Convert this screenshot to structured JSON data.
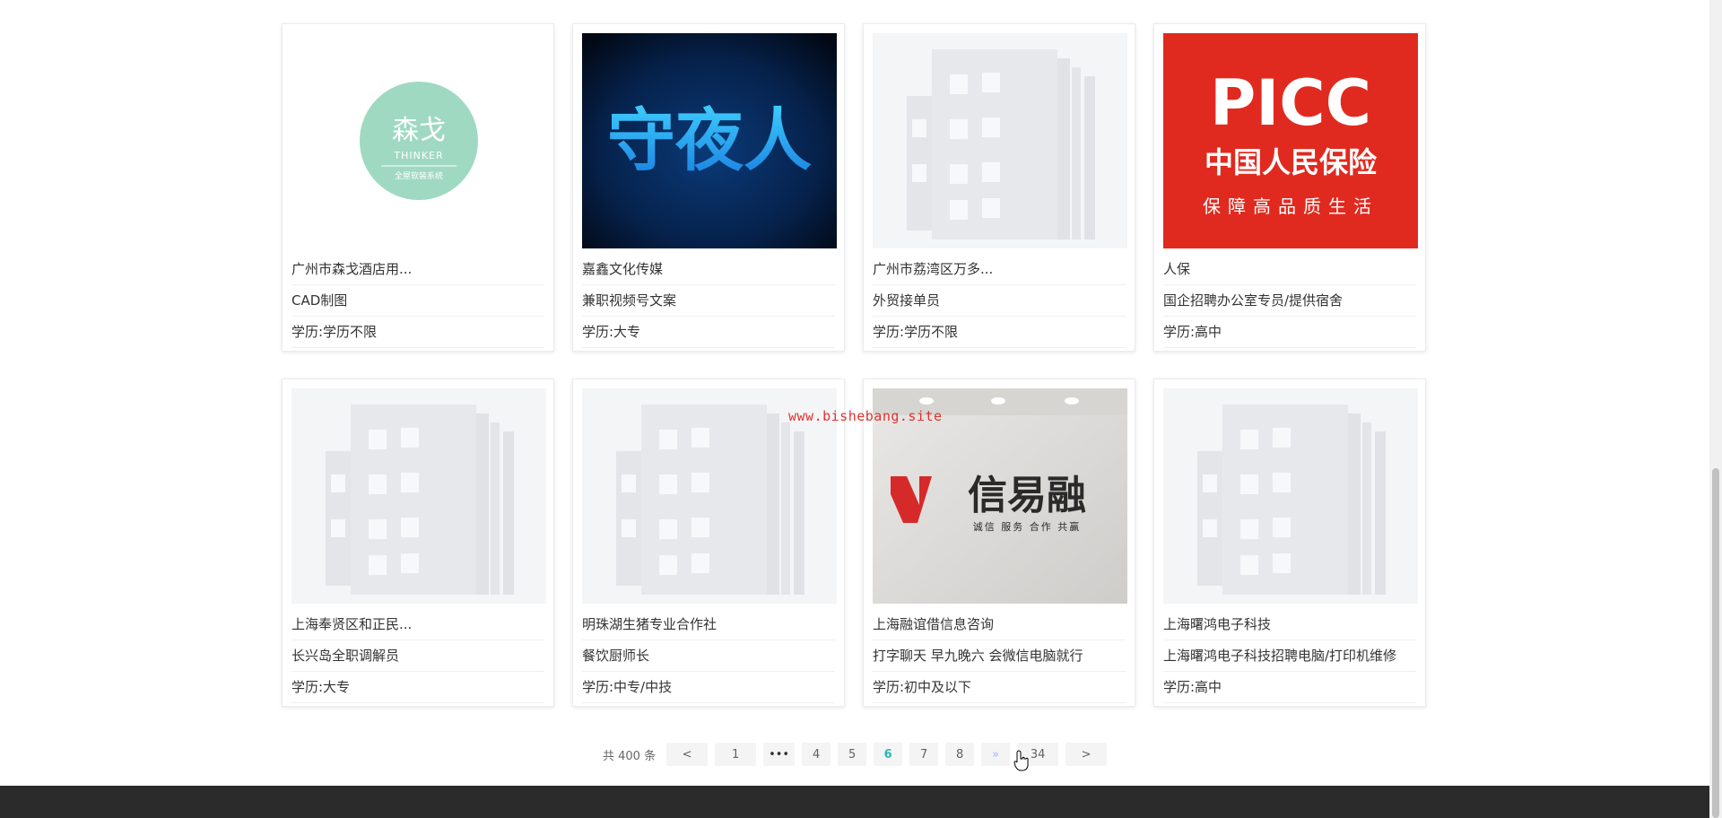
{
  "cards": [
    {
      "company": "广州市森戈酒店用...",
      "job": "CAD制图",
      "edu": "学历:学历不限",
      "logo_type": "thinker",
      "logo_text": "森戈",
      "logo_sub": "THINKER",
      "logo_tag": "全屋软装系统"
    },
    {
      "company": "嘉鑫文化传媒",
      "job": "兼职视频号文案",
      "edu": "学历:大专",
      "logo_type": "shouyeren",
      "logo_text": "守夜人"
    },
    {
      "company": "广州市荔湾区万多...",
      "job": "外贸接单员",
      "edu": "学历:学历不限",
      "logo_type": "placeholder"
    },
    {
      "company": "人保",
      "job": "国企招聘办公室专员/提供宿舍",
      "edu": "学历:高中",
      "logo_type": "picc",
      "logo_text": "PICC",
      "logo_sub": "中国人民保险",
      "logo_tag": "保障高品质生活"
    },
    {
      "company": "上海奉贤区和正民...",
      "job": "长兴岛全职调解员",
      "edu": "学历:大专",
      "logo_type": "placeholder"
    },
    {
      "company": "明珠湖生猪专业合作社",
      "job": "餐饮厨师长",
      "edu": "学历:中专/中技",
      "logo_type": "placeholder"
    },
    {
      "company": "上海融谊借信息咨询",
      "job": "打字聊天 早九晚六 会微信电脑就行",
      "edu": "学历:初中及以下",
      "logo_type": "xinyirong",
      "logo_text": "信易融",
      "logo_sub": "诚信 服务 合作 共赢"
    },
    {
      "company": "上海曙鸿电子科技",
      "job": "上海曙鸿电子科技招聘电脑/打印机维修",
      "edu": "学历:高中",
      "logo_type": "placeholder"
    }
  ],
  "pagination": {
    "total": "共 400 条",
    "prev": "<",
    "next": ">",
    "pages": [
      {
        "label": "1",
        "kind": "page"
      },
      {
        "label": "•••",
        "kind": "dots"
      },
      {
        "label": "4",
        "kind": "page"
      },
      {
        "label": "5",
        "kind": "page"
      },
      {
        "label": "6",
        "kind": "active"
      },
      {
        "label": "7",
        "kind": "page"
      },
      {
        "label": "8",
        "kind": "page"
      },
      {
        "label": "»",
        "kind": "ff"
      },
      {
        "label": "34",
        "kind": "page"
      }
    ]
  },
  "watermark": "www.bishebang.site",
  "colors": {
    "accent": "#28b8b0",
    "picc_red": "#e12a1f",
    "thinker_green": "#9fd9c2",
    "footer": "#2b2b2b"
  }
}
